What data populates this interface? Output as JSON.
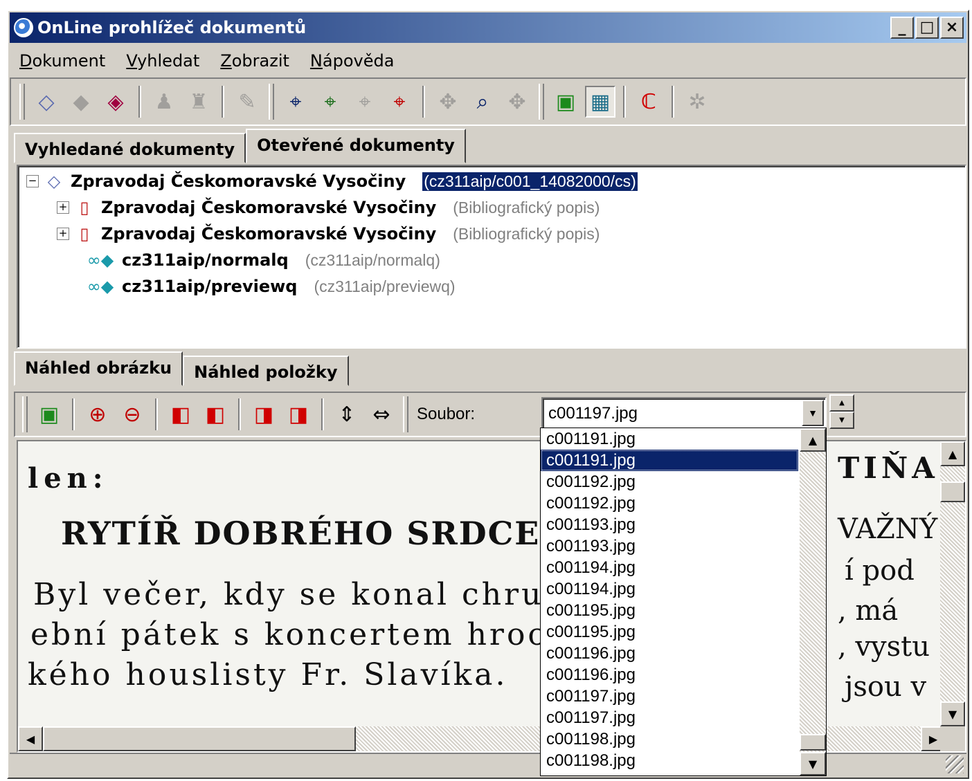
{
  "window": {
    "title": "OnLine prohlížeč dokumentů",
    "controls": [
      "_",
      "□",
      "×"
    ]
  },
  "menu": [
    "Dokument",
    "Vyhledat",
    "Zobrazit",
    "Nápověda"
  ],
  "tabs_top": [
    {
      "label": "Vyhledané dokumenty",
      "active": false
    },
    {
      "label": "Otevřené dokumenty",
      "active": true
    }
  ],
  "tree": {
    "root": {
      "label": "Zpravodaj Českomoravské Vysočiny",
      "id": "(cz311aip/c001_14082000/cs)"
    },
    "children": [
      {
        "label": "Zpravodaj Českomoravské Vysočiny",
        "note": "(Bibliografický popis)"
      },
      {
        "label": "Zpravodaj Českomoravské Vysočiny",
        "note": "(Bibliografický popis)"
      },
      {
        "label": "cz311aip/normalq",
        "note": "(cz311aip/normalq)"
      },
      {
        "label": "cz311aip/previewq",
        "note": "(cz311aip/previewq)"
      }
    ]
  },
  "tabs_bottom": [
    {
      "label": "Náhled obrázku",
      "active": true
    },
    {
      "label": "Náhled položky",
      "active": false
    }
  ],
  "viewer": {
    "file_label": "Soubor:",
    "file_value": "c001197.jpg",
    "scan_lines": [
      "len:",
      "RYTÍŘ DOBRÉHO SRDCE.",
      "Byl večer, kdy se konal chru",
      "ební pátek s koncertem hroc",
      "kého houslisty Fr. Slavíka."
    ],
    "scan_right": [
      "TIŇA",
      "VAŽNÝ",
      "í pod",
      ", má",
      ", vystu",
      "jsou v"
    ]
  },
  "dropdown": {
    "items": [
      "c001191.jpg",
      "c001191.jpg",
      "c001192.jpg",
      "c001192.jpg",
      "c001193.jpg",
      "c001193.jpg",
      "c001194.jpg",
      "c001194.jpg",
      "c001195.jpg",
      "c001195.jpg",
      "c001196.jpg",
      "c001196.jpg",
      "c001197.jpg",
      "c001197.jpg",
      "c001198.jpg",
      "c001198.jpg"
    ],
    "highlighted_index": 1
  }
}
